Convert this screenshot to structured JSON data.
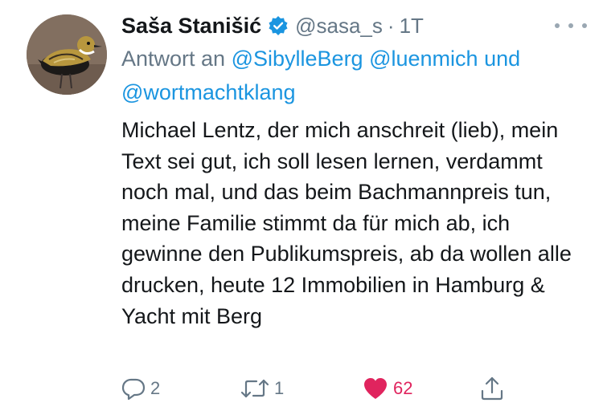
{
  "tweet": {
    "author_name": "Saša Stanišić",
    "author_handle": "@sasa_s",
    "separator": "·",
    "time": "1T",
    "verified": true,
    "reply_prefix": "Antwort an",
    "reply_mentions": [
      "@SibylleBerg",
      "@luenmich",
      "@wortmachtklang"
    ],
    "reply_conjunction": "und",
    "text": "Michael Lentz, der mich anschreit (lieb), mein Text sei gut, ich soll lesen lernen, verdammt noch mal, und das beim Bachmannpreis tun, meine Familie stimmt da für mich ab, ich gewinne den Publikumspreis, ab da wollen alle drucken, heute 12 Immobilien in Hamburg & Yacht mit Berg",
    "actions": {
      "reply_count": "2",
      "retweet_count": "1",
      "like_count": "62",
      "liked": true
    }
  },
  "colors": {
    "accent": "#1b95e0",
    "secondary_text": "#657786",
    "like": "#e0245e"
  },
  "icons": {
    "verified": "verified-badge-icon",
    "more": "more-dots-icon",
    "reply": "reply-bubble-icon",
    "retweet": "retweet-icon",
    "like": "heart-icon",
    "share": "share-icon"
  }
}
